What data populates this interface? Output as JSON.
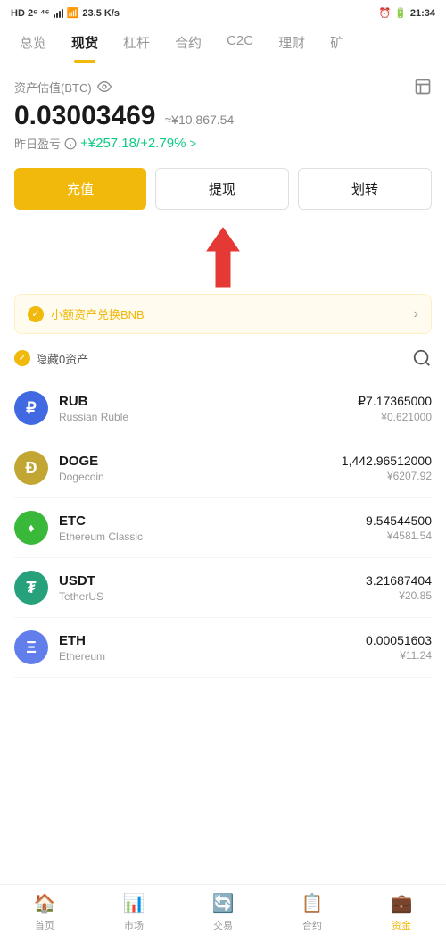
{
  "statusBar": {
    "left": "HD 2G 26 4G",
    "time": "21:34",
    "speed": "23.5 K/s"
  },
  "navTabs": {
    "items": [
      "总览",
      "现货",
      "杠杆",
      "合约",
      "C2C",
      "理财",
      "矿"
    ],
    "active": 1
  },
  "portfolio": {
    "label": "资产估值(BTC)",
    "btcValue": "0.03003469",
    "cnyApprox": "≈¥10,867.54",
    "pnlLabel": "昨日盈亏",
    "pnlValue": "+¥257.18/+2.79%",
    "pnlArrow": ">"
  },
  "actions": {
    "deposit": "充值",
    "withdraw": "提现",
    "transfer": "划转"
  },
  "bnbBanner": {
    "text": "小额资产兑换BNB",
    "chevron": "›"
  },
  "assetFilter": {
    "hideLabel": "隐藏0资产"
  },
  "assets": [
    {
      "symbol": "RUB",
      "name": "Russian Ruble",
      "balance": "₽7.17365000",
      "cny": "¥0.621000",
      "color": "#4169E1",
      "iconText": "₽"
    },
    {
      "symbol": "DOGE",
      "name": "Dogecoin",
      "balance": "1,442.96512000",
      "cny": "¥6207.92",
      "color": "#C2A633",
      "iconText": "Ð"
    },
    {
      "symbol": "ETC",
      "name": "Ethereum Classic",
      "balance": "9.54544500",
      "cny": "¥4581.54",
      "color": "#3AB83A",
      "iconText": "♦"
    },
    {
      "symbol": "USDT",
      "name": "TetherUS",
      "balance": "3.21687404",
      "cny": "¥20.85",
      "color": "#26A17B",
      "iconText": "₮"
    },
    {
      "symbol": "ETH",
      "name": "Ethereum",
      "balance": "0.00051603",
      "cny": "¥11.24",
      "color": "#627EEA",
      "iconText": "Ξ"
    }
  ],
  "bottomNav": {
    "items": [
      "首页",
      "市场",
      "交易",
      "合约",
      "资金"
    ],
    "icons": [
      "🏠",
      "📊",
      "🔄",
      "📋",
      "💼"
    ],
    "active": 4
  }
}
